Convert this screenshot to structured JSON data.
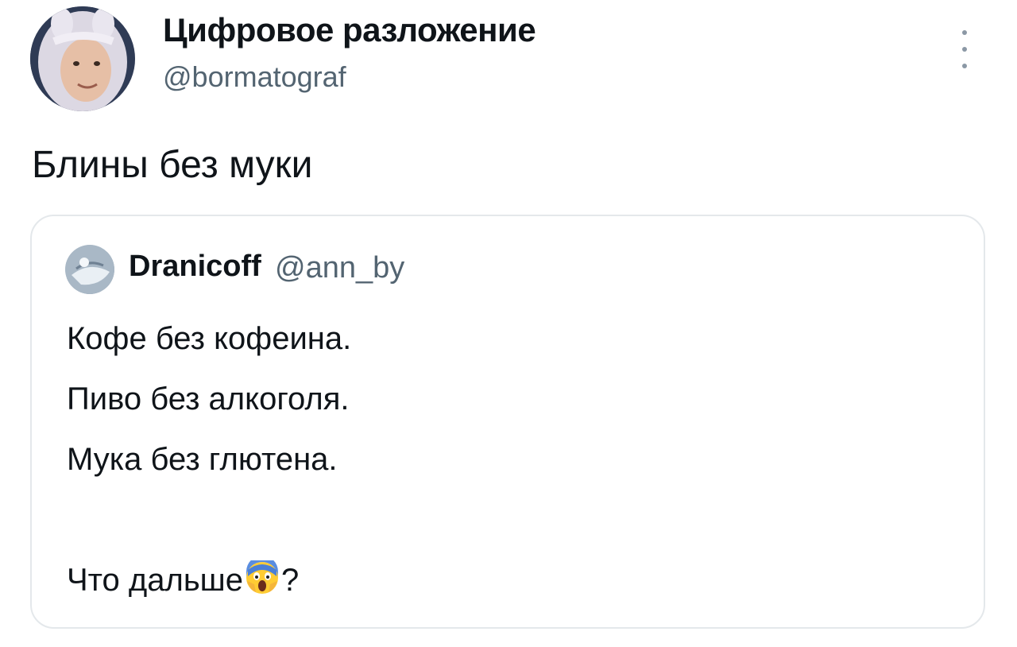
{
  "author": {
    "display_name": "Цифровое разложение",
    "handle": "@bormatograf",
    "avatar_icon": "profile-photo-avatar"
  },
  "tweet": {
    "text": "Блины без муки"
  },
  "quoted_tweet": {
    "author_name": "Dranicoff",
    "author_handle": "@ann_by",
    "avatar_icon": "profile-avatar",
    "lines": [
      "Кофе без кофеина.",
      "Пиво без алкоголя.",
      "Мука без глютена."
    ],
    "last_line_prefix": "Что дальше",
    "last_line_emoji": "screaming-face-emoji",
    "last_line_suffix": "?"
  },
  "icons": {
    "more": "more-vertical-icon"
  },
  "colors": {
    "text_primary": "#0f1419",
    "text_secondary": "#536471",
    "border": "#e4e8eb"
  }
}
